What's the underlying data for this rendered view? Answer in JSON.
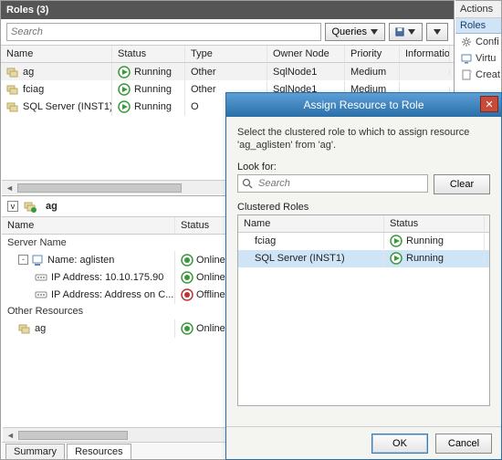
{
  "header": {
    "title": "Roles (3)"
  },
  "search": {
    "placeholder": "Search",
    "queries_label": "Queries"
  },
  "grid": {
    "columns": {
      "name": "Name",
      "status": "Status",
      "type": "Type",
      "owner": "Owner Node",
      "priority": "Priority",
      "info": "Information"
    },
    "rows": [
      {
        "name": "ag",
        "status": "Running",
        "type": "Other",
        "owner": "SqlNode1",
        "priority": "Medium",
        "info": ""
      },
      {
        "name": "fciag",
        "status": "Running",
        "type": "Other",
        "owner": "SqlNode1",
        "priority": "Medium",
        "info": ""
      },
      {
        "name": "SQL Server (INST1)",
        "status": "Running",
        "type": "O",
        "owner": "",
        "priority": "",
        "info": ""
      }
    ]
  },
  "lower": {
    "selected": "ag",
    "columns": {
      "name": "Name",
      "status": "Status"
    },
    "section1": "Server Name",
    "rows1": [
      {
        "name": "Name: aglisten",
        "status": "Online",
        "expand": "-",
        "indent": 1,
        "online": true
      },
      {
        "name": "IP Address: 10.10.175.90",
        "status": "Online",
        "indent": 2,
        "online": true
      },
      {
        "name": "IP Address: Address on C...",
        "status": "Offline",
        "indent": 2,
        "online": false
      }
    ],
    "section2": "Other Resources",
    "rows2": [
      {
        "name": "ag",
        "status": "Online",
        "indent": 1,
        "online": true
      }
    ]
  },
  "tabs": {
    "summary": "Summary",
    "resources": "Resources"
  },
  "actions": {
    "title": "Actions",
    "section": "Roles",
    "items": [
      "Confi",
      "Virtu",
      "Creat"
    ]
  },
  "dialog": {
    "title": "Assign Resource to Role",
    "message": "Select the clustered role to which to assign resource 'ag_aglisten' from 'ag'.",
    "look_for": "Look for:",
    "search_placeholder": "Search",
    "clear": "Clear",
    "list_label": "Clustered Roles",
    "columns": {
      "name": "Name",
      "status": "Status"
    },
    "rows": [
      {
        "name": "fciag",
        "status": "Running"
      },
      {
        "name": "SQL Server (INST1)",
        "status": "Running"
      }
    ],
    "ok": "OK",
    "cancel": "Cancel"
  }
}
